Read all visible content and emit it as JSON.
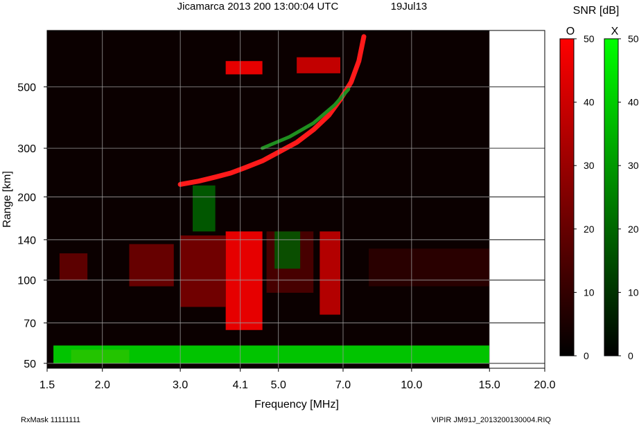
{
  "chart_data": {
    "type": "heatmap",
    "title": "Jicamarca 2013 200 13:00:04 UTC",
    "date": "19Jul13",
    "xlabel": "Frequency [MHz]",
    "ylabel": "Range [km]",
    "x_scale": "log",
    "y_scale": "log",
    "xlim": [
      1.5,
      20.0
    ],
    "ylim": [
      48,
      800
    ],
    "x_ticks": [
      1.5,
      2.0,
      3.0,
      4.1,
      5.0,
      7.0,
      10.0,
      15.0,
      20.0
    ],
    "x_tick_labels": [
      "1.5",
      "2.0",
      "3.0",
      "4.1",
      "5.0",
      "7.0",
      "10.0",
      "15.0",
      "20.0"
    ],
    "y_ticks": [
      50,
      70,
      100,
      140,
      200,
      300,
      500
    ],
    "y_tick_labels": [
      "50",
      "70",
      "100",
      "140",
      "200",
      "300",
      "500"
    ],
    "grid": true,
    "data_frequency_limit": 15.0,
    "colorbar_title": "SNR [dB]",
    "colorbars": [
      {
        "label": "O",
        "color": "#ff0000",
        "ticks": [
          "50",
          "40",
          "30",
          "20",
          "10",
          "0"
        ],
        "range": [
          0,
          50
        ]
      },
      {
        "label": "X",
        "color": "#00ff00",
        "ticks": [
          "50",
          "40",
          "30",
          "20",
          "10",
          "0"
        ],
        "range": [
          0,
          50
        ]
      }
    ],
    "o_trace": [
      {
        "freq": 3.0,
        "range": 222
      },
      {
        "freq": 3.3,
        "range": 228
      },
      {
        "freq": 3.6,
        "range": 236
      },
      {
        "freq": 3.9,
        "range": 244
      },
      {
        "freq": 4.2,
        "range": 255
      },
      {
        "freq": 4.6,
        "range": 270
      },
      {
        "freq": 5.0,
        "range": 290
      },
      {
        "freq": 5.5,
        "range": 315
      },
      {
        "freq": 6.0,
        "range": 350
      },
      {
        "freq": 6.5,
        "range": 395
      },
      {
        "freq": 6.9,
        "range": 450
      },
      {
        "freq": 7.3,
        "range": 520
      },
      {
        "freq": 7.6,
        "range": 620
      },
      {
        "freq": 7.8,
        "range": 760
      }
    ],
    "x_trace": [
      {
        "freq": 4.6,
        "range": 300
      },
      {
        "freq": 5.3,
        "range": 330
      },
      {
        "freq": 6.0,
        "range": 370
      },
      {
        "freq": 6.7,
        "range": 430
      },
      {
        "freq": 7.2,
        "range": 490
      }
    ],
    "o_blocks": [
      {
        "f1": 1.7,
        "f2": 2.3,
        "r1": 50,
        "r2": 56,
        "snr": 45
      },
      {
        "f1": 3.8,
        "f2": 4.6,
        "r1": 66,
        "r2": 150,
        "snr": 45
      },
      {
        "f1": 3.8,
        "f2": 4.6,
        "r1": 555,
        "r2": 620,
        "snr": 45
      },
      {
        "f1": 5.5,
        "f2": 6.9,
        "r1": 560,
        "r2": 640,
        "snr": 38
      },
      {
        "f1": 6.2,
        "f2": 6.9,
        "r1": 75,
        "r2": 150,
        "snr": 35
      },
      {
        "f1": 3.0,
        "f2": 3.8,
        "r1": 80,
        "r2": 145,
        "snr": 22
      },
      {
        "f1": 2.3,
        "f2": 2.9,
        "r1": 95,
        "r2": 135,
        "snr": 20
      },
      {
        "f1": 1.6,
        "f2": 1.85,
        "r1": 100,
        "r2": 125,
        "snr": 18
      },
      {
        "f1": 4.7,
        "f2": 6.0,
        "r1": 90,
        "r2": 150,
        "snr": 14
      },
      {
        "f1": 8.0,
        "f2": 15.0,
        "r1": 95,
        "r2": 130,
        "snr": 8
      }
    ],
    "x_blocks": [
      {
        "f1": 1.55,
        "f2": 15.0,
        "r1": 50,
        "r2": 58,
        "snr": 45
      },
      {
        "f1": 3.2,
        "f2": 3.6,
        "r1": 150,
        "r2": 220,
        "snr": 20
      },
      {
        "f1": 4.9,
        "f2": 5.6,
        "r1": 110,
        "r2": 150,
        "snr": 18
      }
    ]
  },
  "footer": {
    "left": "RxMask 11111111",
    "right": "VIPIR  JM91J_2013200130004.RIQ"
  }
}
